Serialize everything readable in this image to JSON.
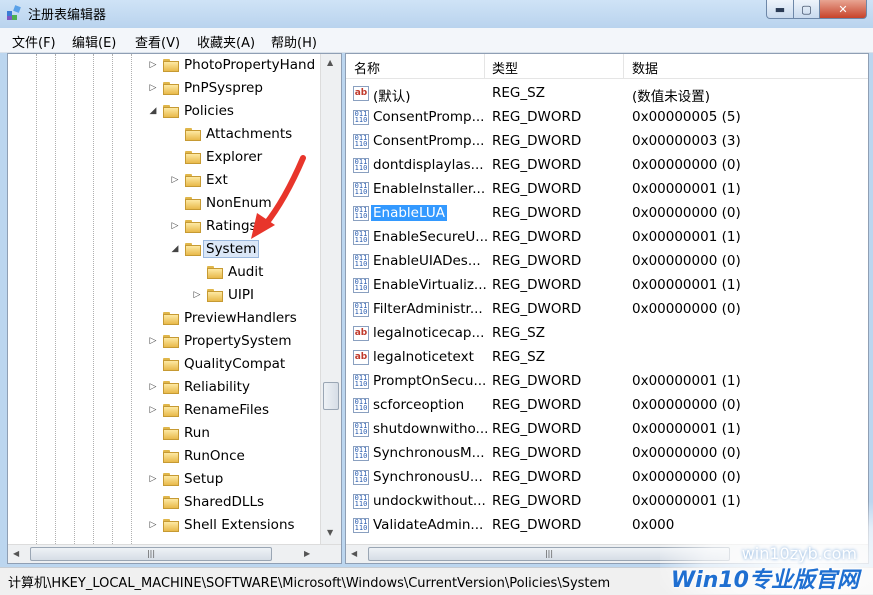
{
  "window": {
    "title": "注册表编辑器",
    "buttons": {
      "minimize": "▬",
      "maximize": "▢",
      "close": "✕"
    }
  },
  "menu": [
    "文件(F)",
    "编辑(E)",
    "查看(V)",
    "收藏夹(A)",
    "帮助(H)"
  ],
  "tree": [
    {
      "label": "PhotoPropertyHand",
      "expander": "▷",
      "selected": false
    },
    {
      "label": "PnPSysprep",
      "expander": "▷",
      "selected": false
    },
    {
      "label": "Policies",
      "expander": "◢",
      "selected": false
    },
    {
      "label": "Attachments",
      "expander": "",
      "selected": false
    },
    {
      "label": "Explorer",
      "expander": "",
      "selected": false
    },
    {
      "label": "Ext",
      "expander": "▷",
      "selected": false
    },
    {
      "label": "NonEnum",
      "expander": "",
      "selected": false
    },
    {
      "label": "Ratings",
      "expander": "▷",
      "selected": false
    },
    {
      "label": "System",
      "expander": "◢",
      "selected": true
    },
    {
      "label": "Audit",
      "expander": "",
      "selected": false
    },
    {
      "label": "UIPI",
      "expander": "▷",
      "selected": false
    },
    {
      "label": "PreviewHandlers",
      "expander": "",
      "selected": false
    },
    {
      "label": "PropertySystem",
      "expander": "▷",
      "selected": false
    },
    {
      "label": "QualityCompat",
      "expander": "",
      "selected": false
    },
    {
      "label": "Reliability",
      "expander": "▷",
      "selected": false
    },
    {
      "label": "RenameFiles",
      "expander": "▷",
      "selected": false
    },
    {
      "label": "Run",
      "expander": "",
      "selected": false
    },
    {
      "label": "RunOnce",
      "expander": "",
      "selected": false
    },
    {
      "label": "Setup",
      "expander": "▷",
      "selected": false
    },
    {
      "label": "SharedDLLs",
      "expander": "",
      "selected": false
    },
    {
      "label": "Shell Extensions",
      "expander": "▷",
      "selected": false
    }
  ],
  "list": {
    "headers": {
      "name": "名称",
      "type": "类型",
      "data": "数据"
    },
    "rows": [
      {
        "icon": "ab",
        "name": "(默认)",
        "type": "REG_SZ",
        "data": "(数值未设置)",
        "selected": false
      },
      {
        "icon": "dw",
        "name": "ConsentPromp...",
        "type": "REG_DWORD",
        "data": "0x00000005 (5)",
        "selected": false
      },
      {
        "icon": "dw",
        "name": "ConsentPromp...",
        "type": "REG_DWORD",
        "data": "0x00000003 (3)",
        "selected": false
      },
      {
        "icon": "dw",
        "name": "dontdisplaylas...",
        "type": "REG_DWORD",
        "data": "0x00000000 (0)",
        "selected": false
      },
      {
        "icon": "dw",
        "name": "EnableInstaller...",
        "type": "REG_DWORD",
        "data": "0x00000001 (1)",
        "selected": false
      },
      {
        "icon": "dw",
        "name": "EnableLUA",
        "type": "REG_DWORD",
        "data": "0x00000000 (0)",
        "selected": true
      },
      {
        "icon": "dw",
        "name": "EnableSecureU...",
        "type": "REG_DWORD",
        "data": "0x00000001 (1)",
        "selected": false
      },
      {
        "icon": "dw",
        "name": "EnableUIADes...",
        "type": "REG_DWORD",
        "data": "0x00000000 (0)",
        "selected": false
      },
      {
        "icon": "dw",
        "name": "EnableVirtualiz...",
        "type": "REG_DWORD",
        "data": "0x00000001 (1)",
        "selected": false
      },
      {
        "icon": "dw",
        "name": "FilterAdministr...",
        "type": "REG_DWORD",
        "data": "0x00000000 (0)",
        "selected": false
      },
      {
        "icon": "ab",
        "name": "legalnoticecap...",
        "type": "REG_SZ",
        "data": "",
        "selected": false
      },
      {
        "icon": "ab",
        "name": "legalnoticetext",
        "type": "REG_SZ",
        "data": "",
        "selected": false
      },
      {
        "icon": "dw",
        "name": "PromptOnSecu...",
        "type": "REG_DWORD",
        "data": "0x00000001 (1)",
        "selected": false
      },
      {
        "icon": "dw",
        "name": "scforceoption",
        "type": "REG_DWORD",
        "data": "0x00000000 (0)",
        "selected": false
      },
      {
        "icon": "dw",
        "name": "shutdownwitho...",
        "type": "REG_DWORD",
        "data": "0x00000001 (1)",
        "selected": false
      },
      {
        "icon": "dw",
        "name": "SynchronousM...",
        "type": "REG_DWORD",
        "data": "0x00000000 (0)",
        "selected": false
      },
      {
        "icon": "dw",
        "name": "SynchronousU...",
        "type": "REG_DWORD",
        "data": "0x00000000 (0)",
        "selected": false
      },
      {
        "icon": "dw",
        "name": "undockwithout...",
        "type": "REG_DWORD",
        "data": "0x00000001 (1)",
        "selected": false
      },
      {
        "icon": "dw",
        "name": "ValidateAdmin...",
        "type": "REG_DWORD",
        "data": "0x000",
        "selected": false
      }
    ]
  },
  "status": {
    "path": "计算机\\HKEY_LOCAL_MACHINE\\SOFTWARE\\Microsoft\\Windows\\CurrentVersion\\Policies\\System"
  },
  "watermark": {
    "site": "win10zyb.com",
    "logo": "Win10专业版官网"
  },
  "colors": {
    "selection": "#3399ff",
    "arrow": "#e8352b",
    "title_bar": "#b9d3ee"
  }
}
